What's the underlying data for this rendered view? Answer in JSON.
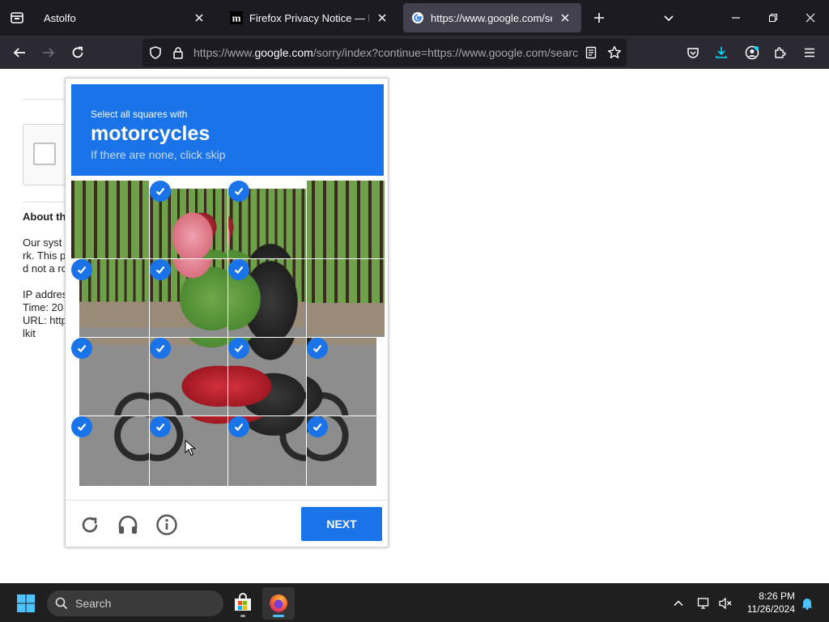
{
  "browser": {
    "tabs": [
      {
        "title": "Astolfo",
        "active": false
      },
      {
        "title": "Firefox Privacy Notice — Mozill",
        "active": false
      },
      {
        "title": "https://www.google.com/searc",
        "active": true
      }
    ],
    "url": {
      "prefix": "https://www.",
      "domain": "google.com",
      "rest": "/sorry/index?continue=https://www.google.com/search"
    }
  },
  "page": {
    "about_heading": "About th",
    "body_lines": [
      "Our syst",
      "rk. This p",
      "d not a ro",
      "IP addres",
      "Time: 20",
      "URL: http",
      "lkit"
    ]
  },
  "challenge": {
    "instruction": "Select all squares with",
    "target": "motorcycles",
    "hint": "If there are none, click skip",
    "next_label": "NEXT",
    "tiles": [
      {
        "row": 0,
        "col": 0,
        "selected": false
      },
      {
        "row": 0,
        "col": 1,
        "selected": true
      },
      {
        "row": 0,
        "col": 2,
        "selected": true
      },
      {
        "row": 0,
        "col": 3,
        "selected": false
      },
      {
        "row": 1,
        "col": 0,
        "selected": true
      },
      {
        "row": 1,
        "col": 1,
        "selected": true
      },
      {
        "row": 1,
        "col": 2,
        "selected": true
      },
      {
        "row": 1,
        "col": 3,
        "selected": false
      },
      {
        "row": 2,
        "col": 0,
        "selected": true
      },
      {
        "row": 2,
        "col": 1,
        "selected": true
      },
      {
        "row": 2,
        "col": 2,
        "selected": true
      },
      {
        "row": 2,
        "col": 3,
        "selected": true
      },
      {
        "row": 3,
        "col": 0,
        "selected": true
      },
      {
        "row": 3,
        "col": 1,
        "selected": true
      },
      {
        "row": 3,
        "col": 2,
        "selected": true
      },
      {
        "row": 3,
        "col": 3,
        "selected": true
      }
    ],
    "footer_icons": [
      "reload-icon",
      "audio-icon",
      "info-icon"
    ]
  },
  "taskbar": {
    "search_label": "Search",
    "time": "8:26 PM",
    "date": "11/26/2024"
  },
  "colors": {
    "accent": "#1a73e8",
    "tabbar_bg": "#1c1b22",
    "navbar_bg": "#2b2a33",
    "download_accent": "#54ffbd"
  }
}
